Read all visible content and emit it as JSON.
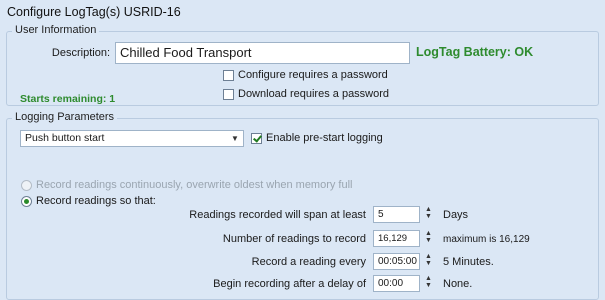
{
  "window": {
    "title": "Configure LogTag(s) USRID-16"
  },
  "user_info": {
    "legend": "User Information",
    "description_label": "Description:",
    "description_value": "Chilled Food Transport",
    "battery_status": "LogTag Battery: OK",
    "configure_password_label": "Configure requires a password",
    "download_password_label": "Download requires a password",
    "starts_remaining": "Starts remaining: 1"
  },
  "logging": {
    "legend": "Logging Parameters",
    "start_mode": "Push button start",
    "prestart_label": "Enable pre-start logging",
    "record_continuously_label": "Record readings continuously, overwrite oldest when memory full",
    "record_so_that_label": "Record readings so that:",
    "span_label": "Readings recorded will span at least",
    "span_value": "5",
    "span_unit": "Days",
    "number_label": "Number of readings to record",
    "number_value": "16,129",
    "number_max": "maximum is 16,129",
    "interval_label": "Record a reading every",
    "interval_value": "00:05:00",
    "interval_text": "5 Minutes.",
    "delay_label": "Begin recording after a delay of",
    "delay_value": "00:00",
    "delay_text": "None."
  },
  "icons": {
    "spin_up": "▲",
    "spin_down": "▼",
    "dropdown": "▼"
  }
}
